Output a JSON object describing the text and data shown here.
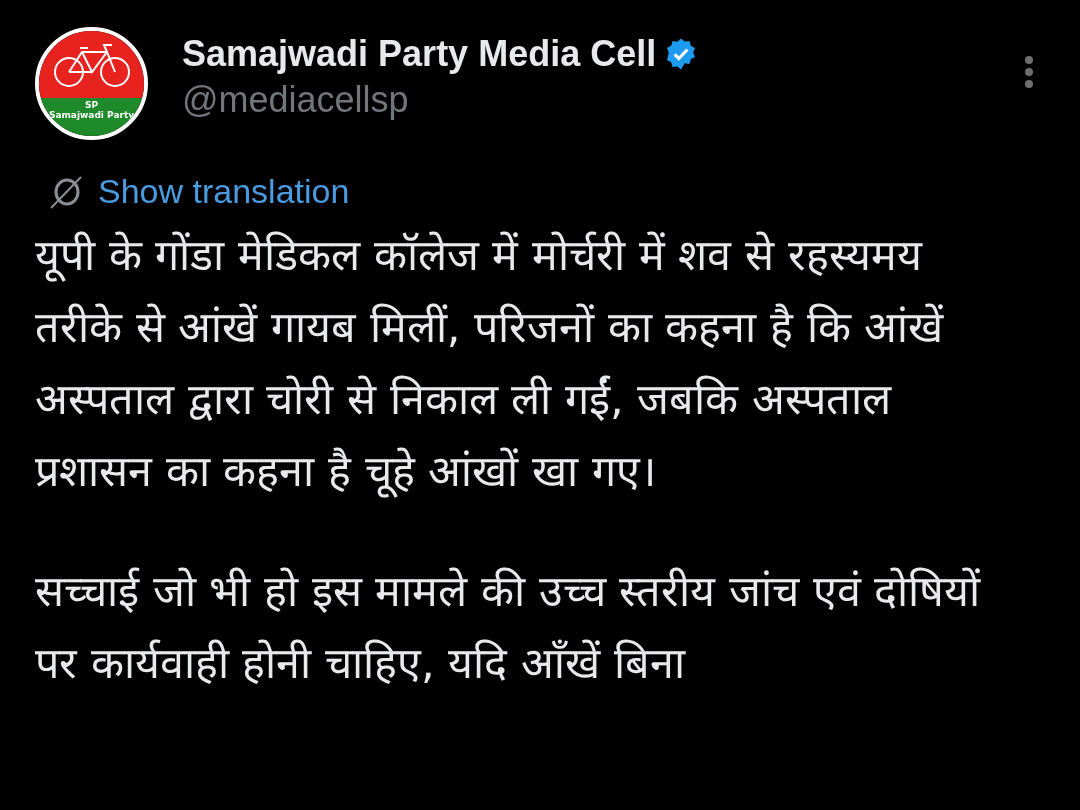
{
  "author": {
    "name": "Samajwadi Party Media Cell",
    "verified": true,
    "handle": "@mediacellsp",
    "avatar": {
      "abbreviation": "SP",
      "caption": "Samajwadi Party"
    }
  },
  "translate_link": "Show translation",
  "paragraphs": [
    "यूपी के गोंडा मेडिकल कॉलेज में मोर्चरी में शव से रहस्यमय तरीके से आंखें गायब मिलीं, परिजनों का कहना है कि आंखें अस्पताल द्वारा चोरी से निकाल ली गईं, जबकि अस्पताल प्रशासन का कहना है चूहे आंखों खा गए।",
    "सच्चाई जो भी हो इस मामले की उच्च स्तरीय जांच एवं दोषियों पर कार्यवाही होनी चाहिए, यदि आँखें बिना"
  ]
}
